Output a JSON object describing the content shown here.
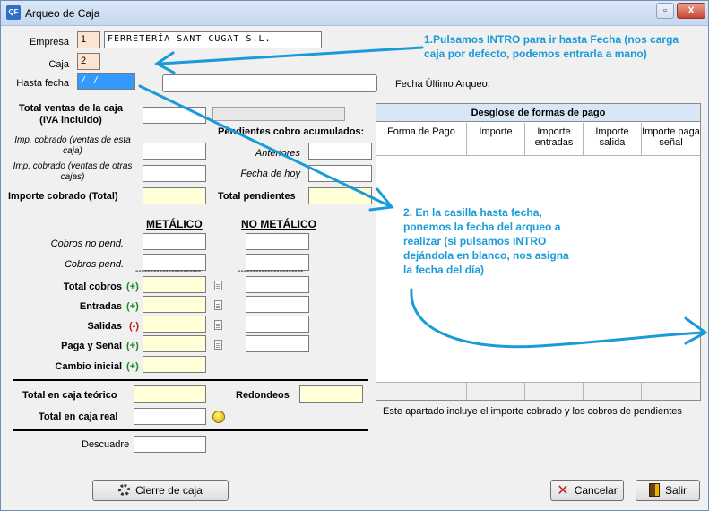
{
  "window": {
    "title": "Arqueo de Caja",
    "app_icon_text": "QF",
    "minimize": "▫",
    "maximize": "▭",
    "close": "X"
  },
  "header": {
    "empresa_label": "Empresa",
    "empresa_code": "1",
    "empresa_name": "FERRETERÍA SANT CUGAT S.L.",
    "caja_label": "Caja",
    "caja_code": "2",
    "hasta_fecha_label": "Hasta fecha",
    "hasta_fecha_value": " /  /",
    "fecha_ultimo_label": "Fecha Último Arqueo:"
  },
  "ventas": {
    "total_label": "Total ventas de la caja (IVA incluido)",
    "imp_esta_label": "Imp. cobrado (ventas de esta caja)",
    "imp_otras_label": "Imp. cobrado (ventas de otras cajas)",
    "importe_total_label": "Importe cobrado (Total)"
  },
  "pendientes": {
    "title": "Pendientes cobro acumulados:",
    "anteriores_label": "Anteriores",
    "fecha_hoy_label": "Fecha de hoy",
    "total_label": "Total pendientes"
  },
  "columns": {
    "metalico": "METÁLICO",
    "no_metalico": "NO METÁLICO",
    "dashes": "------------------------------",
    "dashes2": "----------------------"
  },
  "rows": {
    "cobros_no_pend": "Cobros no pend.",
    "cobros_pend": "Cobros pend.",
    "total_cobros": "Total cobros",
    "entradas": "Entradas",
    "salidas": "Salidas",
    "paga_senal": "Paga y Señal",
    "cambio_inicial": "Cambio inicial",
    "plus": "(+)",
    "minus": "(-)"
  },
  "totales": {
    "teorico": "Total en caja teórico",
    "redondeos": "Redondeos",
    "real": "Total en caja real",
    "descuadre": "Descuadre"
  },
  "grid": {
    "title": "Desglose de formas de pago",
    "col1": "Forma de Pago",
    "col2": "Importe",
    "col3": "Importe entradas",
    "col4": "Importe salida",
    "col5": "Importe paga señal",
    "note": "Este apartado incluye el importe cobrado y los cobros de pendientes"
  },
  "buttons": {
    "cierre": "Cierre de caja",
    "cancelar": "Cancelar",
    "salir": "Salir"
  },
  "annotations": {
    "a1": "1.Pulsamos INTRO para ir hasta Fecha  (nos carga caja por defecto, podemos entrarla a mano)",
    "a2": "2. En la casilla hasta fecha, ponemos la fecha del arqueo a realizar (si pulsamos INTRO dejándola en blanco, nos asigna la fecha del día)"
  },
  "colors": {
    "annotation": "#1a9bd8",
    "peach": "#fde4d0",
    "yellow": "#ffffd8",
    "selection": "#3399ff"
  }
}
